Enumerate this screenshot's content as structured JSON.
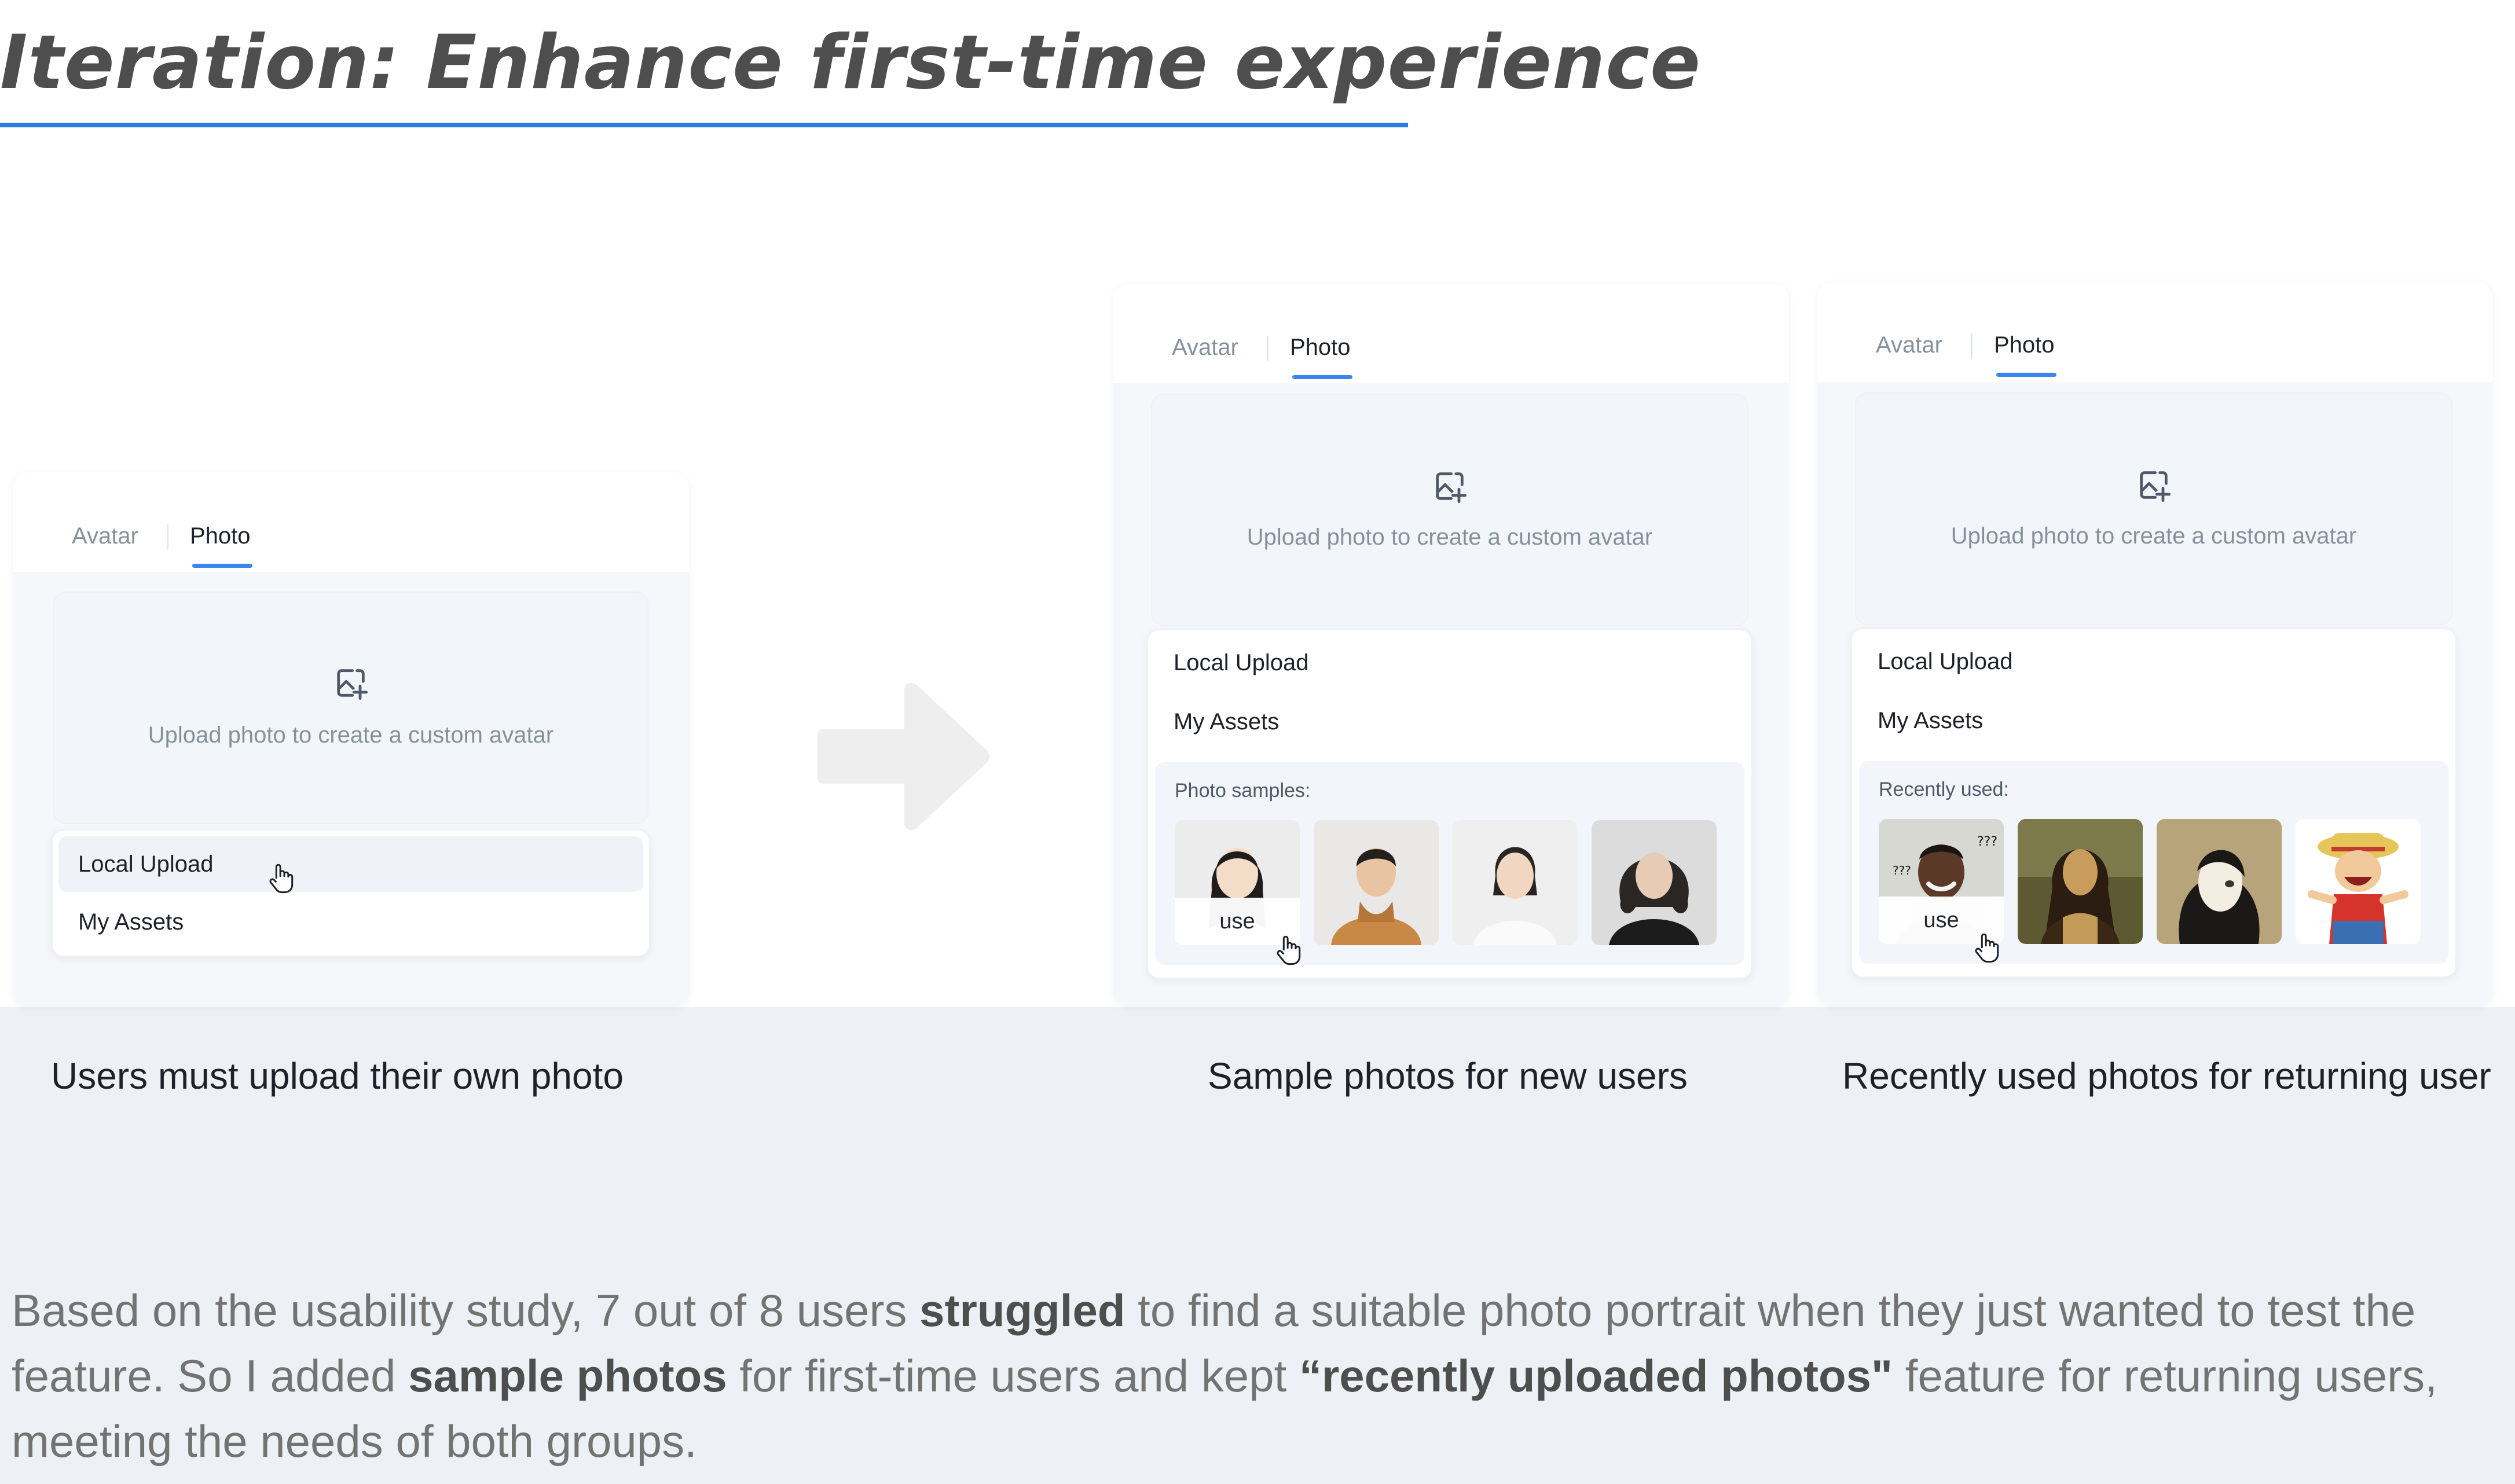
{
  "page": {
    "title": "Iteration: Enhance first-time experience"
  },
  "panels": [
    {
      "tabs": [
        "Avatar",
        "Photo"
      ],
      "active_tab": "Photo",
      "upload_label": "Upload photo to create a custom avatar",
      "menu": [
        "Local Upload",
        "My Assets"
      ],
      "caption": "Users must upload their own photo"
    },
    {
      "tabs": [
        "Avatar",
        "Photo"
      ],
      "active_tab": "Photo",
      "upload_label": "Upload photo to create a custom avatar",
      "menu": [
        "Local Upload",
        "My Assets"
      ],
      "samples_label": "Photo samples:",
      "use_label": "use",
      "caption": "Sample photos for new users"
    },
    {
      "tabs": [
        "Avatar",
        "Photo"
      ],
      "active_tab": "Photo",
      "upload_label": "Upload photo to create a custom avatar",
      "menu": [
        "Local Upload",
        "My Assets"
      ],
      "samples_label": "Recently used:",
      "use_label": "use",
      "caption": "Recently used photos for returning user"
    }
  ],
  "description": {
    "p1": "Based on the usability study, 7 out of 8 users ",
    "b1": "struggled",
    "p2": " to find a suitable photo portrait when they just wanted to test the feature. So I added ",
    "b2": "sample photos",
    "p3": " for first-time users and kept ",
    "b3": "“recently uploaded photos\"",
    "p4": " feature for returning users, meeting the needs of both groups."
  },
  "colors": {
    "accent": "#3a86f0",
    "title_underline": "#2f7de1",
    "band": "#edf1f5"
  },
  "icons": [
    "upload-image-icon",
    "hand-cursor-icon",
    "arrow-right-icon"
  ]
}
